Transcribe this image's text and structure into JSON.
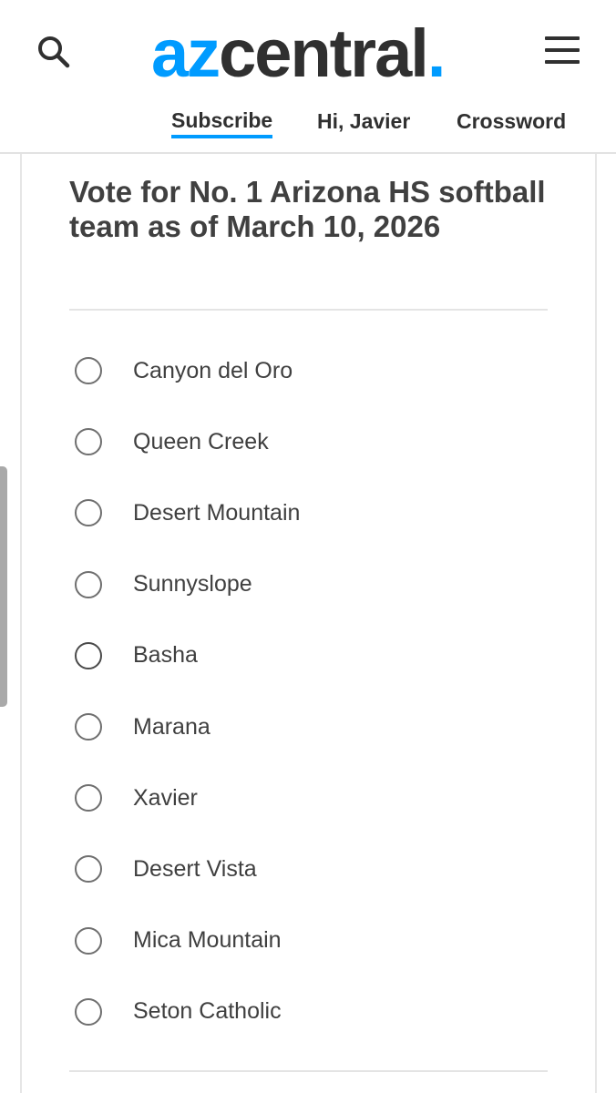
{
  "header": {
    "logo": {
      "az": "az",
      "central": "central",
      "dot": "."
    },
    "search_icon": "search-icon",
    "menu_icon": "hamburger-menu-icon",
    "nav": {
      "subscribe": "Subscribe",
      "greeting": "Hi, Javier",
      "crossword": "Crossword"
    },
    "colors": {
      "brand_blue": "#009bff",
      "text_dark": "#303030"
    }
  },
  "poll": {
    "title": "Vote for No. 1 Arizona HS softball team as of March 10, 2026",
    "options": [
      "Canyon del Oro",
      "Queen Creek",
      "Desert Mountain",
      "Sunnyslope",
      "Basha",
      "Marana",
      "Xavier",
      "Desert Vista",
      "Mica Mountain",
      "Seton Catholic"
    ]
  }
}
